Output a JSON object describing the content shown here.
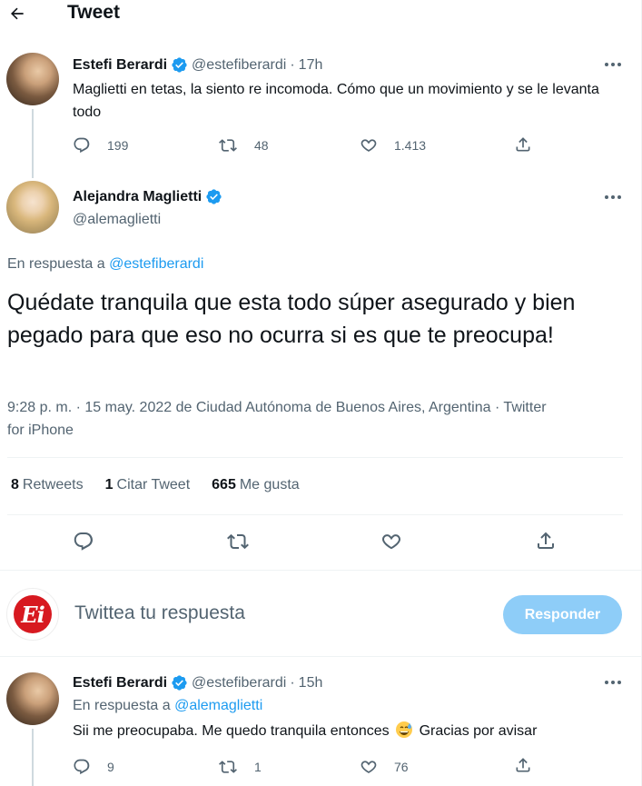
{
  "header": {
    "title": "Tweet"
  },
  "colors": {
    "accent": "#1d9bf0",
    "muted": "#536471",
    "like": "#f91880",
    "reply_button": "#8ecdf8",
    "brand_ei": "#d71920"
  },
  "icons": {
    "back": "arrow-left-icon",
    "verified": "verified-badge-icon",
    "more": "more-dots-icon",
    "reply": "reply-icon",
    "retweet": "retweet-icon",
    "like": "heart-icon",
    "share": "share-icon"
  },
  "parent_tweet": {
    "name": "Estefi Berardi",
    "handle": "@estefiberardi",
    "dot": "·",
    "time": "17h",
    "text": "Maglietti en tetas, la siento re incomoda. Cómo que un movimiento y se le levanta todo",
    "replies": "199",
    "retweets": "48",
    "likes": "1.413"
  },
  "main_tweet": {
    "name": "Alejandra Maglietti",
    "handle": "@alemaglietti",
    "reply_prefix": "En respuesta a",
    "reply_mention": "@estefiberardi",
    "text": "Quédate tranquila que esta todo súper asegurado y bien pegado para que eso no ocurra si es que te preocupa!",
    "meta": "9:28 p. m. · 15 may. 2022 de Ciudad Autónoma de Buenos Aires, Argentina · Twitter for iPhone",
    "stats": {
      "retweets_count": "8",
      "retweets_label": "Retweets",
      "quotes_count": "1",
      "quotes_label": "Citar Tweet",
      "likes_count": "665",
      "likes_label": "Me gusta"
    }
  },
  "compose": {
    "avatar_text": "Ei",
    "placeholder": "Twittea tu respuesta",
    "button_label": "Responder"
  },
  "reply_tweet": {
    "name": "Estefi Berardi",
    "handle": "@estefiberardi",
    "dot": "·",
    "time": "15h",
    "reply_prefix": "En respuesta a",
    "reply_mention": "@alemaglietti",
    "text_before": "Sii me preocupaba. Me quedo tranquila entonces",
    "emoji": "grinning-sweat-emoji",
    "text_after": "Gracias por avisar",
    "replies": "9",
    "retweets": "1",
    "likes": "76"
  }
}
